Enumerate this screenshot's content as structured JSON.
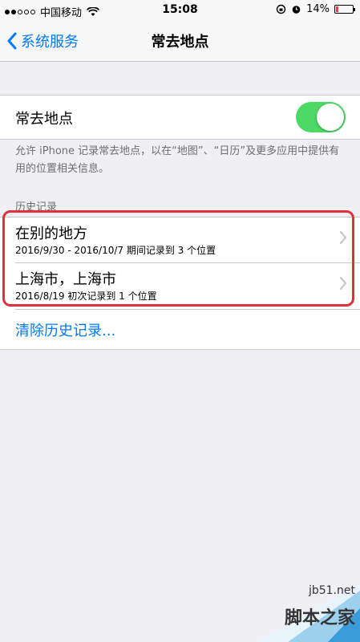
{
  "status_bar": {
    "carrier": "中国移动",
    "time": "15:08",
    "battery": "14%",
    "battery_level": 0.14
  },
  "nav": {
    "back_label": "系统服务",
    "title": "常去地点"
  },
  "toggle_section": {
    "label": "常去地点",
    "enabled": true,
    "footnote": "允许 iPhone 记录常去地点，以在“地图”、“日历”及更多应用中提供有用的位置相关信息。"
  },
  "history": {
    "header": "历史记录",
    "rows": [
      {
        "title": "在别的地方",
        "subtitle": "2016/9/30 - 2016/10/7 期间记录到 3 个位置"
      },
      {
        "title": "上海市，上海市",
        "subtitle": "2016/8/19 初次记录到 1 个位置"
      }
    ],
    "clear_label": "清除历史记录..."
  },
  "colors": {
    "accent": "#007aff",
    "toggle_on": "#4cd964",
    "highlight": "#e0303c",
    "battery_low": "#ff3b30"
  },
  "watermark": {
    "url": "jb51.net",
    "text": "脚本之家"
  }
}
